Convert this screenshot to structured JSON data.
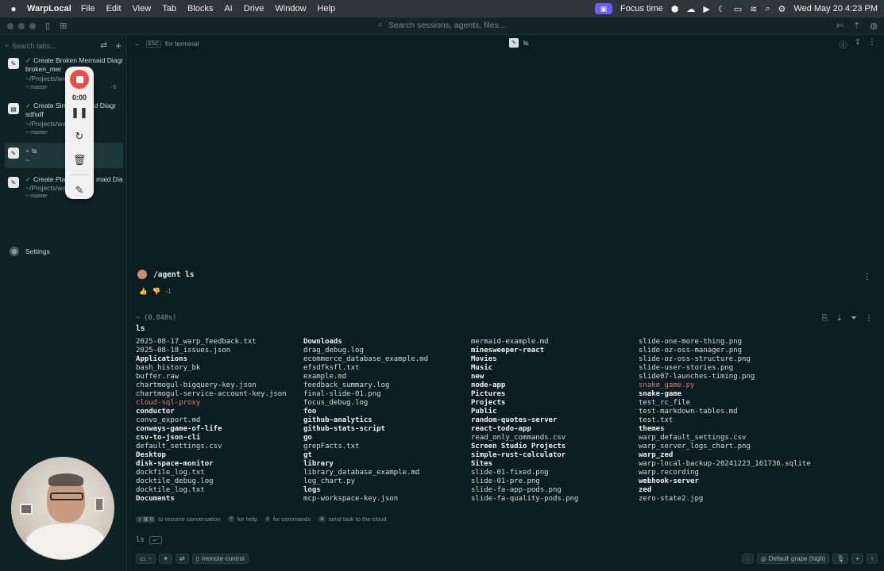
{
  "menubar": {
    "app_name": "WarpLocal",
    "menus": [
      "File",
      "Edit",
      "View",
      "Tab",
      "Blocks",
      "AI",
      "Drive",
      "Window",
      "Help"
    ],
    "focus_label": "Focus time",
    "datetime": "Wed May 20  4:23 PM"
  },
  "toolbar": {
    "search_placeholder": "Search sessions, agents, files..."
  },
  "sidebar": {
    "search_placeholder": "Search tabs...",
    "tabs": [
      {
        "title": "Create Broken Mermaid Diagr",
        "subtitle": "broken_mer",
        "path": "~/Projects/wa",
        "branch": "master",
        "badge": "-5"
      },
      {
        "title": "Create Sim",
        "title_tail": "d Diagr",
        "subtitle": "sdfsdf",
        "path": "~/Projects/wa",
        "branch": "master"
      },
      {
        "title": "ls",
        "subtitle": "~"
      },
      {
        "title": "Create Plan",
        "title_tail": "maid Dia",
        "path": "~/Projects/wa",
        "branch": "master"
      }
    ],
    "settings_label": "Settings"
  },
  "recorder": {
    "time": "0:00"
  },
  "pane": {
    "esc_key": "ESC",
    "esc_label": "for terminal",
    "title": "ls"
  },
  "agent": {
    "command": "/agent ls",
    "rating_extra": "-1"
  },
  "block": {
    "meta": "~ (0.048s)",
    "command": "ls",
    "columns": [
      [
        {
          "t": "2025-08-17_warp_feedback.txt"
        },
        {
          "t": "2025-08-18_issues.json"
        },
        {
          "t": "Applications",
          "c": "dir"
        },
        {
          "t": "bash_history_bk"
        },
        {
          "t": "buffer.raw"
        },
        {
          "t": "chartmogul-bigquery-key.json"
        },
        {
          "t": "chartmogul-service-account-key.json"
        },
        {
          "t": "cloud-sql-proxy",
          "c": "red"
        },
        {
          "t": "conductor",
          "c": "dir"
        },
        {
          "t": "convo_export.md"
        },
        {
          "t": "conways-game-of-life",
          "c": "dir"
        },
        {
          "t": "csv-to-json-cli",
          "c": "dir"
        },
        {
          "t": "default_settings.csv"
        },
        {
          "t": "Desktop",
          "c": "dir"
        },
        {
          "t": "disk-space-monitor",
          "c": "dir"
        },
        {
          "t": "dockfile_log.txt"
        },
        {
          "t": "docktile_debug.log"
        },
        {
          "t": "docktile_log.txt"
        },
        {
          "t": "Documents",
          "c": "dir"
        }
      ],
      [
        {
          "t": "Downloads",
          "c": "dir"
        },
        {
          "t": "drag_debug.log"
        },
        {
          "t": "ecommerce_database_example.md"
        },
        {
          "t": "efsdfksfl.txt"
        },
        {
          "t": "example.md"
        },
        {
          "t": "feedback_summary.log"
        },
        {
          "t": "final-slide-01.png"
        },
        {
          "t": "focus_debug.log"
        },
        {
          "t": "foo",
          "c": "dir"
        },
        {
          "t": "github-analytics",
          "c": "dir"
        },
        {
          "t": "github-stats-script",
          "c": "dir"
        },
        {
          "t": "go",
          "c": "dir"
        },
        {
          "t": "grepFacts.txt"
        },
        {
          "t": "gt",
          "c": "dir"
        },
        {
          "t": "library",
          "c": "dir"
        },
        {
          "t": "library_database_example.md"
        },
        {
          "t": "log_chart.py"
        },
        {
          "t": "logs",
          "c": "dir"
        },
        {
          "t": "mcp-workspace-key.json"
        }
      ],
      [
        {
          "t": "mermaid-example.md"
        },
        {
          "t": "minesweeper-react",
          "c": "dir"
        },
        {
          "t": "Movies",
          "c": "dir"
        },
        {
          "t": "Music",
          "c": "dir"
        },
        {
          "t": "new",
          "c": "dir"
        },
        {
          "t": "node-app",
          "c": "dir"
        },
        {
          "t": "Pictures",
          "c": "dir"
        },
        {
          "t": "Projects",
          "c": "dir"
        },
        {
          "t": "Public",
          "c": "dir"
        },
        {
          "t": "random-quotes-server",
          "c": "dir"
        },
        {
          "t": "react-todo-app",
          "c": "dir"
        },
        {
          "t": "read_only_commands.csv"
        },
        {
          "t": "Screen Studio Projects",
          "c": "dir"
        },
        {
          "t": "simple-rust-calculator",
          "c": "dir"
        },
        {
          "t": "Sites",
          "c": "dir"
        },
        {
          "t": "slide-01-fixed.png"
        },
        {
          "t": "slide-01-pre.png"
        },
        {
          "t": "slide-fa-app-pods.png"
        },
        {
          "t": "slide-fa-quality-pods.png"
        }
      ],
      [
        {
          "t": "slide-one-more-thing.png"
        },
        {
          "t": "slide-oz-oss-manager.png"
        },
        {
          "t": "slide-oz-oss-structure.png"
        },
        {
          "t": "slide-user-stories.png"
        },
        {
          "t": "slide07-launches-timing.png"
        },
        {
          "t": "snake_game.py",
          "c": "red"
        },
        {
          "t": "snake-game",
          "c": "dir"
        },
        {
          "t": "test_rc_file"
        },
        {
          "t": "test-markdown-tables.md"
        },
        {
          "t": "test.txt"
        },
        {
          "t": "themes",
          "c": "dir"
        },
        {
          "t": "warp_default_settings.csv"
        },
        {
          "t": "warp_server_logs_chart.png"
        },
        {
          "t": "warp_zed",
          "c": "dir"
        },
        {
          "t": "warp-local-backup-20241223_161736.sqlite"
        },
        {
          "t": "warp.recording"
        },
        {
          "t": "webhook-server",
          "c": "dir"
        },
        {
          "t": "zed",
          "c": "dir"
        },
        {
          "t": "zero-state2.jpg"
        }
      ]
    ]
  },
  "hints": {
    "resume_keys": "⇧ ⌘ R",
    "resume_label": "to resume conversation",
    "help_key": "?",
    "help_label": "for help",
    "commands_key": "/",
    "commands_label": "for commands",
    "cloud_key": "&",
    "cloud_label": "send task to the cloud"
  },
  "input": {
    "value": "ls",
    "submit_hint": "→·"
  },
  "bottom": {
    "folder": "~",
    "path_label": "/remote-control",
    "profile": "Default",
    "model": "grape (high)"
  }
}
